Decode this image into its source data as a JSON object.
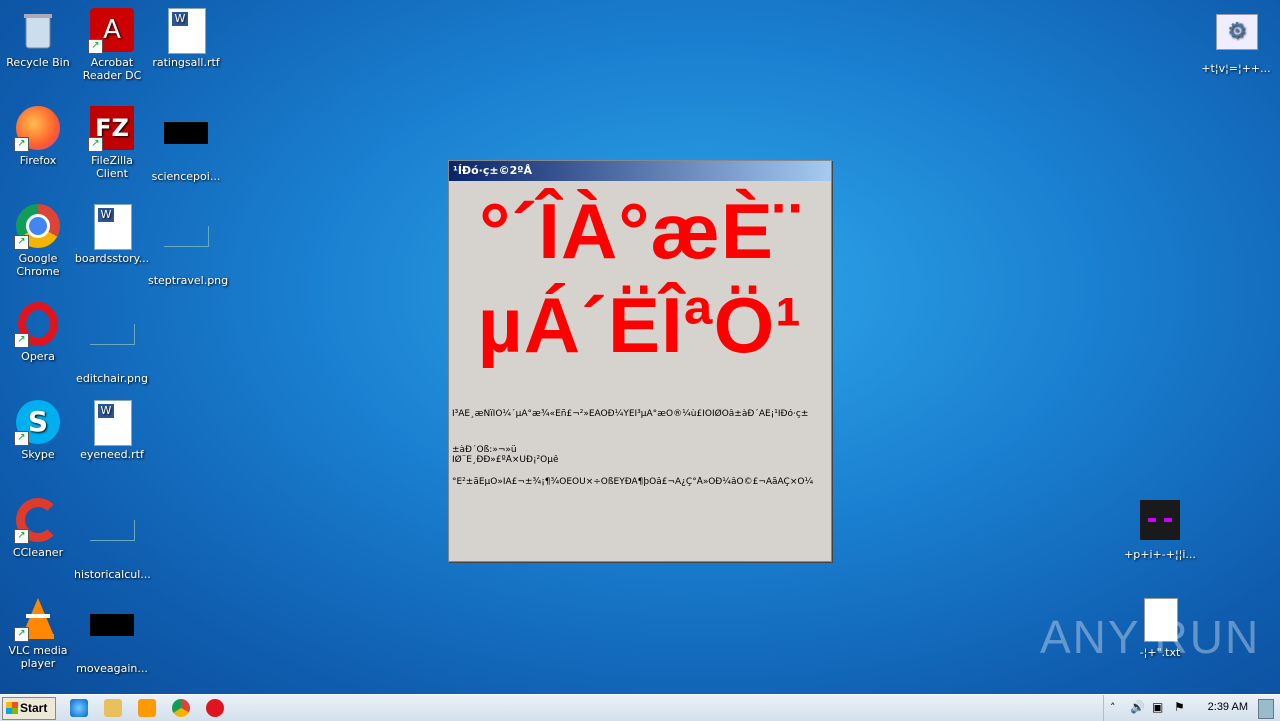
{
  "desktop": {
    "icons_left": [
      {
        "label": "Recycle Bin"
      },
      {
        "label": "Acrobat Reader DC"
      },
      {
        "label": "ratingsall.rtf"
      },
      {
        "label": "Firefox"
      },
      {
        "label": "FileZilla Client"
      },
      {
        "label": "sciencepoi..."
      },
      {
        "label": "Google Chrome"
      },
      {
        "label": "boardsstory..."
      },
      {
        "label": "steptravel.png"
      },
      {
        "label": "Opera"
      },
      {
        "label": "editchair.png"
      },
      {
        "label": "Skype"
      },
      {
        "label": "eyeneed.rtf"
      },
      {
        "label": "CCleaner"
      },
      {
        "label": "historicalcul..."
      },
      {
        "label": "VLC media player"
      },
      {
        "label": "moveagain..."
      }
    ],
    "icons_right": [
      {
        "label": "+t¦v¦=¦++..."
      },
      {
        "label": "+p+i+-+¦¦i..."
      },
      {
        "label": "-¦+\".txt"
      }
    ]
  },
  "dialog": {
    "title": "¹ÍÐó·ç±©2ºÅ",
    "big_line1": "°´ÎÀ°æÈ¨",
    "big_line2": "µÁ´ËÎªÖ¹",
    "text_line1": "Î³ÁÉ¸æÑïÎÒ¼´µÁ°æ¾«Éñ£¬²»ÊÃÕÐ¼ÝÊÎ³µÁ°æÖ®¼ù£ÎÒÌØÕâ±àÐ´ÁË¡¹ÍÐó·ç±",
    "text_line2": "±àÐ´Õß:»¬»ü",
    "text_line3": "ÏØ¨É¸ÐÐ»£ºÅ×ÛÐ¡²Ôµê",
    "text_line4": "°É²±ãËµÒ»ÎÂ£¬±¾¡¶¾ÓÉÔÙ×÷ÕßÈÝÐÁ¶þÒâ£¬Ä¿Ç°Å»ÓÐ¼âÒ©£¬ÄãÃÇ×Ö¼"
  },
  "taskbar": {
    "start_label": "Start",
    "clock": "2:39 AM"
  },
  "watermark": "ANY RUN"
}
